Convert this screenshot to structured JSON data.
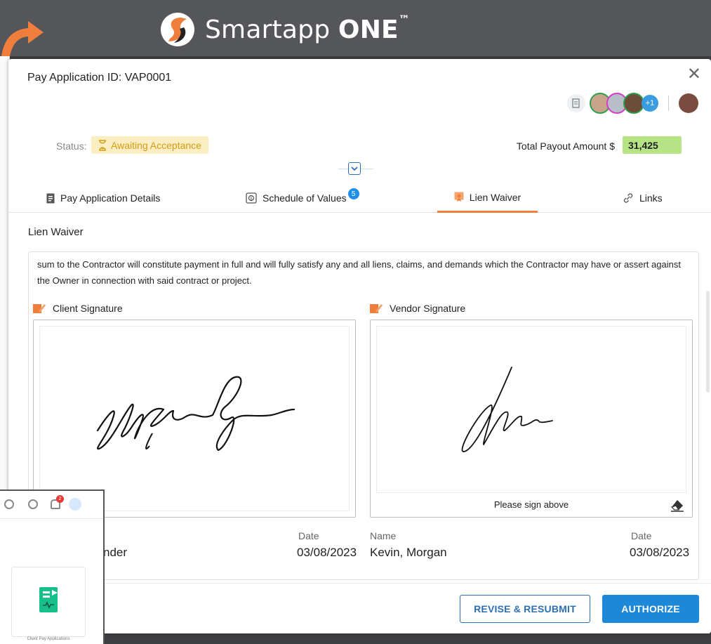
{
  "banner": {
    "brand_name": "Smartapp",
    "brand_bold": "ONE",
    "brand_tm": "™",
    "accent_color": "#ef7d3c"
  },
  "modal": {
    "title": "Pay Application ID: VAP0001",
    "close_icon": "close-icon",
    "avatars": {
      "extra_count": "+1"
    },
    "status": {
      "label": "Status:",
      "value": "Awaiting Acceptance",
      "icon": "hourglass-icon"
    },
    "payout": {
      "label": "Total Payout Amount $",
      "value": "31,425"
    },
    "tabs": [
      {
        "label": "Pay Application Details",
        "icon": "document-icon"
      },
      {
        "label": "Schedule of Values",
        "icon": "money-icon",
        "badge": "5"
      },
      {
        "label": "Lien Waiver",
        "icon": "certificate-icon",
        "active": true
      },
      {
        "label": "Links",
        "icon": "link-icon"
      }
    ],
    "section_title": "Lien Waiver",
    "waiver_text": "sum to the Contractor will constitute payment in full and will fully satisfy any and all liens, claims, and demands which the Contractor may have or assert against the Owner in connection with said contract or project.",
    "client": {
      "label": "Client Signature",
      "name_fragment": "nder",
      "date_label": "Date",
      "date": "03/08/2023"
    },
    "vendor": {
      "label": "Vendor Signature",
      "hint": "Please sign above",
      "name_label": "Name",
      "name": "Kevin, Morgan",
      "date_label": "Date",
      "date": "03/08/2023"
    },
    "buttons": {
      "revise": "REVISE & RESUBMIT",
      "authorize": "AUTHORIZE"
    }
  },
  "inset": {
    "notification_count": "2",
    "card_label": "Client Pay Applications"
  }
}
